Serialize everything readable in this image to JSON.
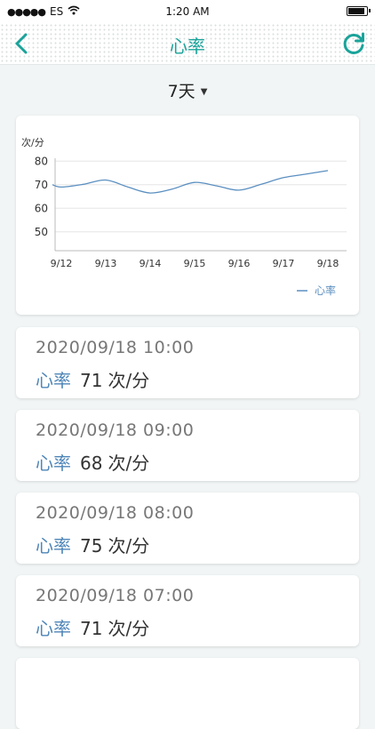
{
  "status": {
    "carrier": "ES",
    "time": "1:20 AM"
  },
  "nav": {
    "title": "心率"
  },
  "range": {
    "selected": "7天"
  },
  "chart_data": {
    "type": "line",
    "ylabel": "次/分",
    "categories": [
      "9/12",
      "9/13",
      "9/14",
      "9/15",
      "9/16",
      "9/17",
      "9/18"
    ],
    "yticks": [
      50,
      60,
      70,
      80
    ],
    "ylim": [
      42,
      82
    ],
    "series": [
      {
        "name": "心率",
        "color": "#5b8fc0",
        "x": [
          11.8,
          12.0,
          12.5,
          13.0,
          13.5,
          14.0,
          14.5,
          15.0,
          15.5,
          16.0,
          16.5,
          17.0,
          17.5,
          18.0
        ],
        "y": [
          70,
          69,
          70.2,
          72,
          69,
          66.5,
          68.2,
          71,
          69.5,
          67.7,
          70.2,
          73,
          74.5,
          76
        ]
      }
    ],
    "legend": "bottom-right",
    "grid": true
  },
  "records": [
    {
      "time": "2020/09/18 10:00",
      "label": "心率",
      "value": "71",
      "unit": "次/分"
    },
    {
      "time": "2020/09/18 09:00",
      "label": "心率",
      "value": "68",
      "unit": "次/分"
    },
    {
      "time": "2020/09/18 08:00",
      "label": "心率",
      "value": "75",
      "unit": "次/分"
    },
    {
      "time": "2020/09/18 07:00",
      "label": "心率",
      "value": "71",
      "unit": "次/分"
    }
  ]
}
